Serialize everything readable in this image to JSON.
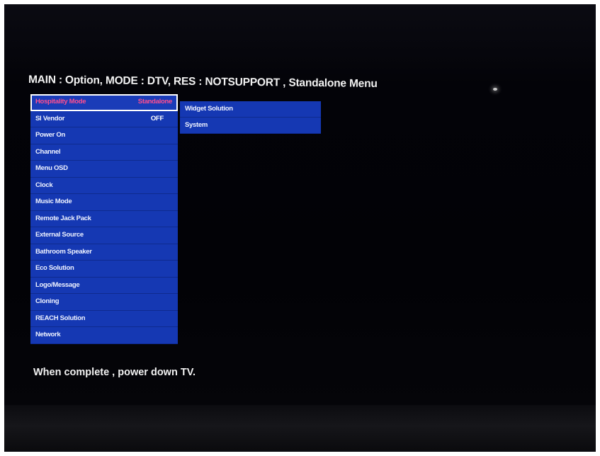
{
  "header": {
    "text": "MAIN : Option, MODE : DTV, RES : NOTSUPPORT , Standalone Menu"
  },
  "main_menu": {
    "items": [
      {
        "label": "Hospitality Mode",
        "value": "Standalone",
        "selected": true
      },
      {
        "label": "SI Vendor",
        "value": "OFF"
      },
      {
        "label": "Power On"
      },
      {
        "label": "Channel"
      },
      {
        "label": "Menu OSD"
      },
      {
        "label": "Clock"
      },
      {
        "label": "Music Mode"
      },
      {
        "label": "Remote Jack Pack"
      },
      {
        "label": "External Source"
      },
      {
        "label": "Bathroom Speaker"
      },
      {
        "label": "Eco Solution"
      },
      {
        "label": "Logo/Message"
      },
      {
        "label": "Cloning"
      },
      {
        "label": "REACH Solution"
      },
      {
        "label": "Network"
      }
    ]
  },
  "sub_menu": {
    "items": [
      {
        "label": "Widget Solution"
      },
      {
        "label": "System"
      }
    ]
  },
  "footer": {
    "text": "When complete , power down TV."
  },
  "colors": {
    "menu_background": "#1538b3",
    "selected_text": "#ff4f8f",
    "selection_border": "#ffffff",
    "screen_background": "#040408",
    "text": "#f2f2f2"
  }
}
